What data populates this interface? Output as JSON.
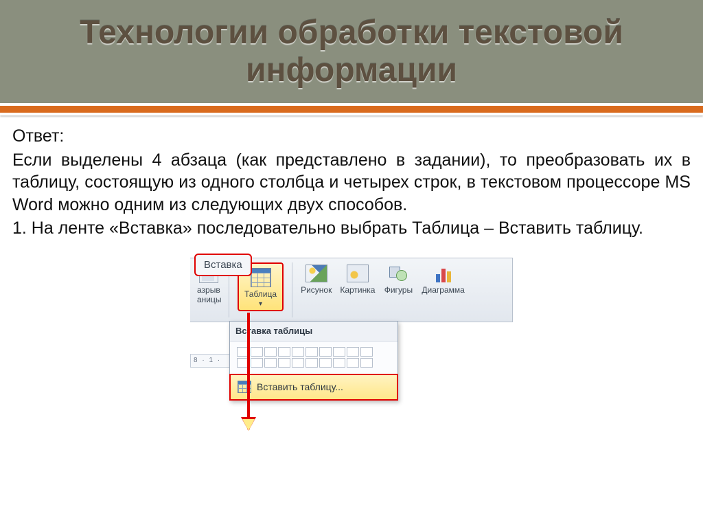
{
  "header": {
    "title": "Технологии обработки текстовой информации"
  },
  "content": {
    "answer_label": "Ответ:",
    "para1": "Если выделены 4 абзаца (как представлено в задании), то преобразовать их в таблицу, состоящую из одного столбца и четырех строк, в текстовом процессоре MS Word можно одним из следующих двух способов.",
    "para2": "1. На ленте «Вставка» последовательно выбрать Таблица – Вставить таблицу."
  },
  "ribbon": {
    "tab": "Вставка",
    "break_btn_l1": "азрыв",
    "break_btn_l2": "аницы",
    "table_btn": "Таблица",
    "picture_btn": "Рисунок",
    "clipart_btn": "Картинка",
    "shapes_btn": "Фигуры",
    "chart_btn": "Диаграмма"
  },
  "dropdown": {
    "title": "Вставка таблицы",
    "insert_table": "Вставить таблицу..."
  },
  "ruler": "8 · 1 ·"
}
